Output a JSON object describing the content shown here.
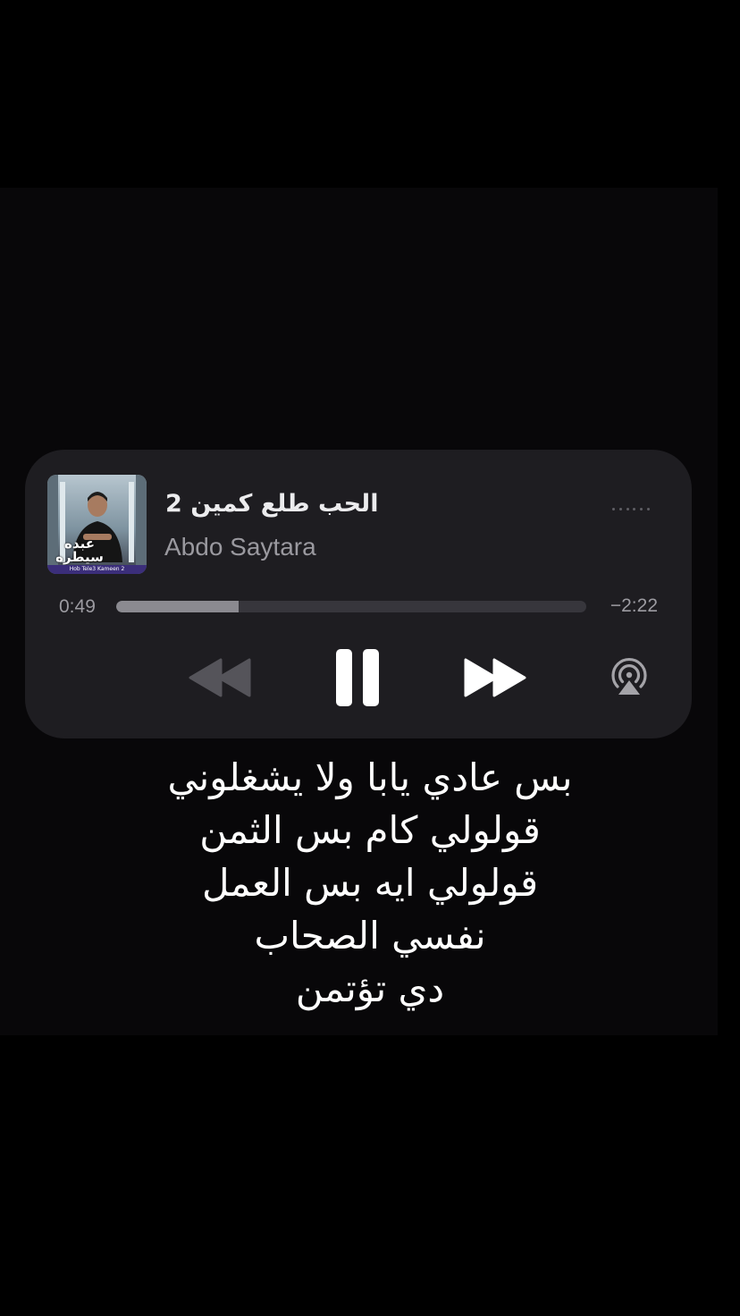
{
  "player": {
    "title": "الحب طلع كمين 2",
    "artist": "Abdo Saytara",
    "artwork": {
      "logo_text": "عبده سيطره",
      "caption": "Hob Tele3 Kameen 2"
    },
    "time_elapsed": "0:49",
    "time_remaining": "−2:22",
    "progress_fraction": 0.26,
    "state": "playing",
    "icons": {
      "more": "more-dots-icon",
      "rewind": "rewind-icon",
      "pause": "pause-icon",
      "forward": "fast-forward-icon",
      "airplay": "airplay-icon"
    },
    "colors": {
      "card_background": "#1e1d21",
      "progress_fill": "#8b8a90",
      "progress_track": "#37363c"
    }
  },
  "lyrics": [
    "بس عادي يابا ولا يشغلوني",
    "قولولي كام بس الثمن",
    "قولولي ايه بس العمل",
    "نفسي الصحاب",
    "دي تؤتمن"
  ]
}
